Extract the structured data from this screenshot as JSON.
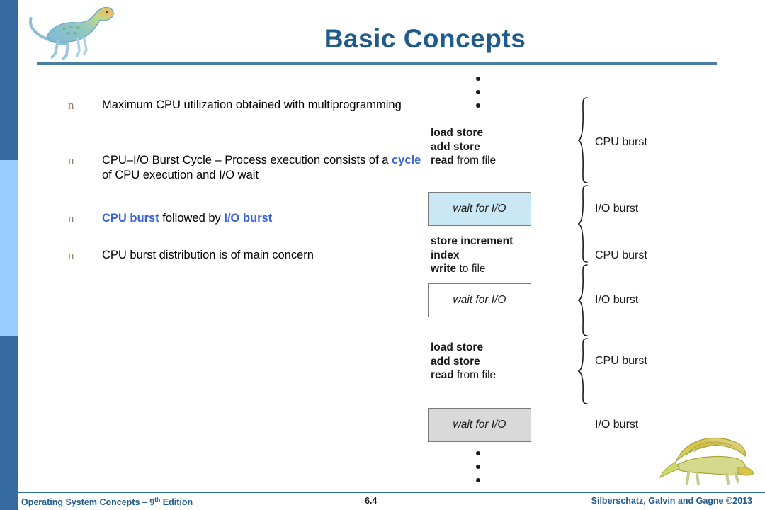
{
  "slide": {
    "title": "Basic Concepts",
    "logo_top": "dinosaur-logo",
    "logo_bottom": "dimetrodon-logo"
  },
  "colors": {
    "band_dark": "#36699E",
    "band_light": "#99CCFF",
    "title": "#1F5C8B",
    "highlight": "#3A63D8",
    "bullet_marker": "#9A7B5A",
    "io_box_1_fill": "#C9E7F5",
    "io_box_2_fill": "#FFFFFF",
    "io_box_3_fill": "#D9D9D9"
  },
  "bullets": [
    {
      "marker": "n",
      "parts": [
        {
          "text": "Maximum CPU utilization obtained with multiprogramming",
          "style": "plain"
        }
      ]
    },
    {
      "marker": "n",
      "parts": [
        {
          "text": "CPU–I/O Burst Cycle – Process execution consists of a ",
          "style": "plain"
        },
        {
          "text": "cycle",
          "style": "highlight"
        },
        {
          "text": " of CPU execution and I/O wait",
          "style": "plain"
        }
      ]
    },
    {
      "marker": "n",
      "parts": [
        {
          "text": "CPU burst",
          "style": "highlight"
        },
        {
          "text": " followed by ",
          "style": "plain"
        },
        {
          "text": "I/O burst",
          "style": "highlight"
        }
      ]
    },
    {
      "marker": "n",
      "parts": [
        {
          "text": "CPU burst distribution is of main concern",
          "style": "plain"
        }
      ]
    }
  ],
  "figure": {
    "ellipsis_top": "• • •",
    "ellipsis_bottom": "• • •",
    "code_block_1": [
      {
        "bold": "load store",
        "rest": ""
      },
      {
        "bold": "add store",
        "rest": ""
      },
      {
        "bold": "read",
        "rest": " from file"
      }
    ],
    "code_block_2": [
      {
        "bold": "store increment",
        "rest": ""
      },
      {
        "bold": "index",
        "rest": ""
      },
      {
        "bold": "write",
        "rest": " to file"
      }
    ],
    "code_block_3": [
      {
        "bold": "load store",
        "rest": ""
      },
      {
        "bold": "add store",
        "rest": ""
      },
      {
        "bold": "read",
        "rest": " from file"
      }
    ],
    "io_box_1_label": "wait for I/O",
    "io_box_2_label": "wait for I/O",
    "io_box_3_label": "wait for I/O",
    "burst_labels": [
      "CPU burst",
      "I/O burst",
      "CPU burst",
      "I/O burst",
      "CPU burst",
      "I/O burst"
    ]
  },
  "footer": {
    "left_main": "Operating System Concepts – 9",
    "left_sup": "th",
    "left_tail": " Edition",
    "page": "6.4",
    "right": "Silberschatz, Galvin and Gagne ©2013"
  }
}
